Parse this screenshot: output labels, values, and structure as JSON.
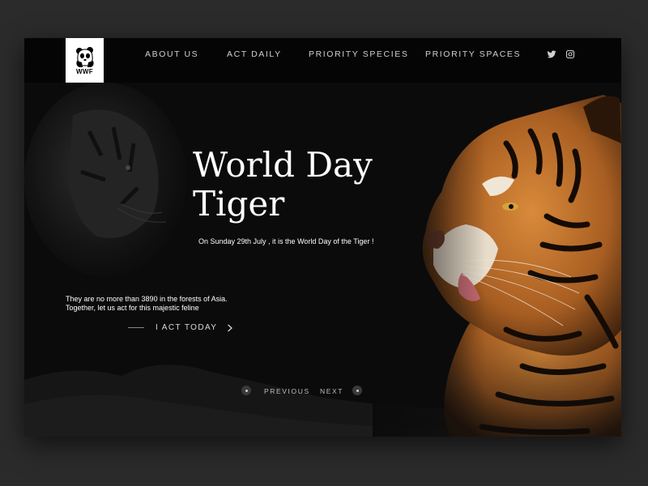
{
  "brand": {
    "name": "WWF"
  },
  "nav": {
    "items": [
      {
        "label": "ABOUT US"
      },
      {
        "label": "ACT DAILY"
      },
      {
        "label": "PRIORITY SPECIES"
      },
      {
        "label": "PRIORITY SPACES"
      }
    ],
    "social": [
      {
        "icon": "twitter-icon"
      },
      {
        "icon": "instagram-icon"
      }
    ]
  },
  "hero": {
    "title_line1": "World Day",
    "title_line2": "Tiger",
    "subtitle": "On Sunday 29th July , it is the World Day of the Tiger !",
    "description_line1": "They are no more than 3890 in the forests of Asia.",
    "description_line2": "Together, let us act for this majestic feline",
    "cta_label": "I ACT TODAY"
  },
  "pager": {
    "previous_label": "PREVIOUS",
    "next_label": "NEXT"
  },
  "colors": {
    "page_background": "#2b2b2b",
    "card_background": "#0b0b0b",
    "tiger_orange": "#c9782f",
    "text": "#ffffff"
  }
}
